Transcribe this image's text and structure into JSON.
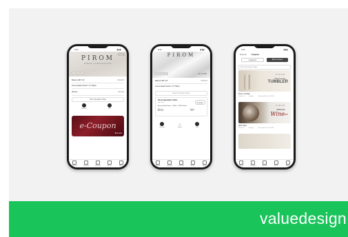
{
  "phone1": {
    "time": "9:41",
    "signal": "▮▮▮",
    "brand": "PIROM",
    "brand_sub": "PIROM CORPORATION",
    "pill_left": "BEST SELLER",
    "pill_right": "Guest",
    "balance_label": "Balance ₩ 7,00",
    "balance_right": "Points 5",
    "accumulated": "Accumulated Points: 17,750pts",
    "field_left": "Identity",
    "field_right": "Amount",
    "select_label": "Pirom Specialty Coffee",
    "btn1": "Gift Pay",
    "btn2": "QR",
    "coupon_text": "e-Coupon",
    "coupon_cta": "Buy more",
    "coupon_color": "#7a1520"
  },
  "phone2": {
    "time": "9:41",
    "signal": "▮▮▮",
    "brand": "PIROM",
    "pill_left": "BEST SELLER",
    "pill_right": "GO TO APP",
    "balance_label": "Balance ₩ 7,00",
    "balance_right": "Points 5",
    "accumulated": "Accumulated Points: 17,750pts",
    "search_placeholder": "Search Specialty Coffee",
    "card_title": "Pirom Specialty Coffee",
    "card_sub": "Gift Card",
    "card_action": "Ⓜ Share",
    "card_detail": "Accumulated Points : 10000 · 12000 Points",
    "card_amt_label": "Balance",
    "card_amt": "₩ 5,400",
    "card_exp_label": "Expire",
    "card_exp": "2023",
    "btn1": "Gift Pay",
    "btn2": "Points",
    "btn3": "QR"
  },
  "phone3": {
    "time": "9:41",
    "signal": "▮▮▮",
    "tab_a": "Discover",
    "tab_b": "Coupons",
    "seg_a": "Categories",
    "seg_b": "Brand Coupon",
    "search_placeholder": "Pirom Specialty Coffee",
    "prod1_brand": "PIROM",
    "prod1_head": "PRIVILEGE",
    "prod1_title": "TUMBLER",
    "prod1_name": "Pirom Tumbler",
    "prod1_meta_l": "Pirom Co.",
    "prod1_meta_m": "Tumbler",
    "prod1_meta_r": "Sale until Dec 31, 2023",
    "prod2_brand": "PIROM",
    "prod2_head": "SPECIAL",
    "prod2_title": "Wine",
    "prod2_tag": "SHOP",
    "prod2_name": "Wine Shot",
    "prod2_meta_l": "Pirom Co.",
    "prod2_meta_m": "Coupon",
    "prod2_meta_r": "Sale until Dec 31, 2023"
  },
  "tabs": [
    "Home",
    "Coupon",
    "Benefit",
    "Menu",
    "More"
  ],
  "footer": {
    "watermark": "valuedesign",
    "color": "#19c45a"
  }
}
